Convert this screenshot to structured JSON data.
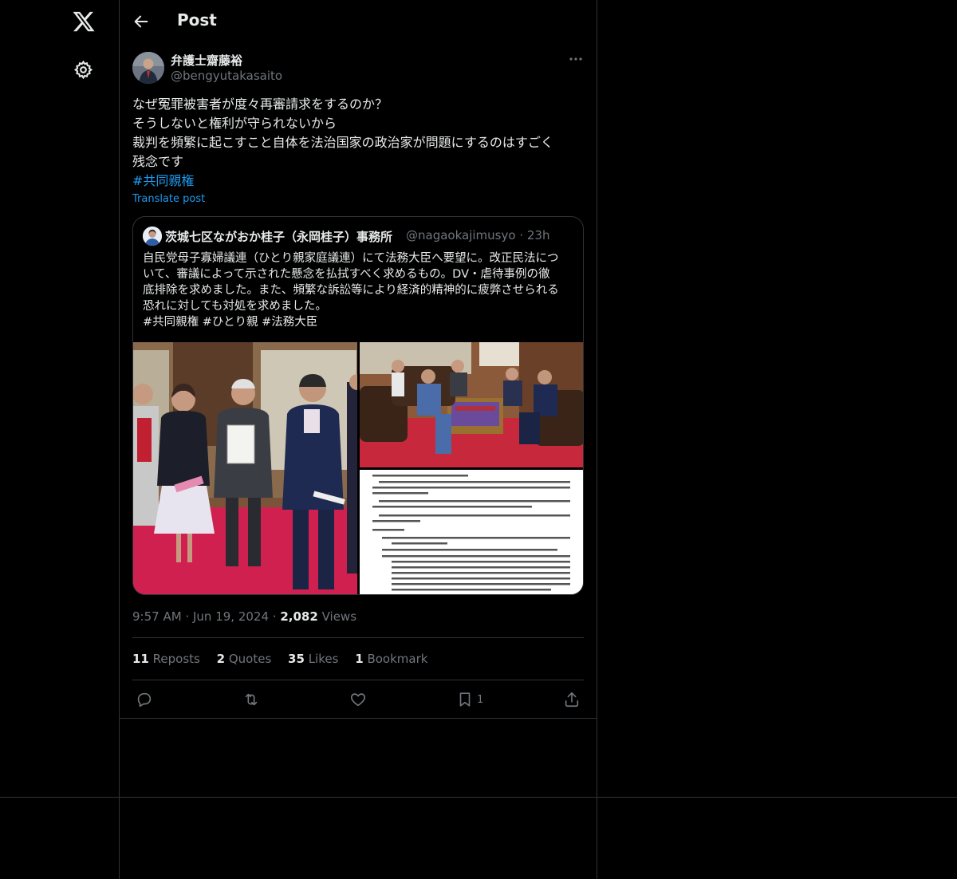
{
  "nav": {
    "logo_icon": "x-logo-icon",
    "settings_icon": "gear-icon"
  },
  "header": {
    "title": "Post",
    "back_icon": "arrow-left-icon"
  },
  "post": {
    "author_name": "弁護士齋藤裕",
    "author_handle": "@bengyutakasaito",
    "lines": [
      "なぜ冤罪被害者が度々再審請求をするのか？",
      "そうしないと権利が守られないから",
      "裁判を頻繁に起こすこと自体を法治国家の政治家が問題にするのはすごく",
      "残念です"
    ],
    "hashtag": "#共同親権",
    "translate_label": "Translate post",
    "time": "9:57 AM",
    "date": "Jun 19, 2024",
    "views_count": "2,082",
    "views_label": "Views",
    "sep": "·"
  },
  "quote": {
    "name": "茨城七区ながおか桂子（永岡桂子）事務所",
    "handle": "@nagaokajimusyo",
    "age": "23h",
    "sep": "·",
    "lines": [
      "自民党母子寡婦議連（ひとり親家庭議連）にて法務大臣へ要望に。改正民法につ",
      "いて、審議によって示された懸念を払拭すべく求めるもの。DV・虐待事例の徹",
      "底排除を求めました。また、頻繁な訴訟等により経済的精神的に疲弊させられる",
      "恐れに対しても対処を求めました。",
      "#共同親権 #ひとり親 #法務大臣"
    ]
  },
  "stats": {
    "reposts_count": "11",
    "reposts_label": "Reposts",
    "quotes_count": "2",
    "quotes_label": "Quotes",
    "likes_count": "35",
    "likes_label": "Likes",
    "bookmarks_count": "1",
    "bookmarks_label": "Bookmark"
  },
  "actions": {
    "bookmark_count": "1"
  },
  "colors": {
    "background": "#000000",
    "text": "#e7e9ea",
    "muted": "#71767b",
    "accent": "#1d9bf0",
    "border": "#2f3336"
  }
}
